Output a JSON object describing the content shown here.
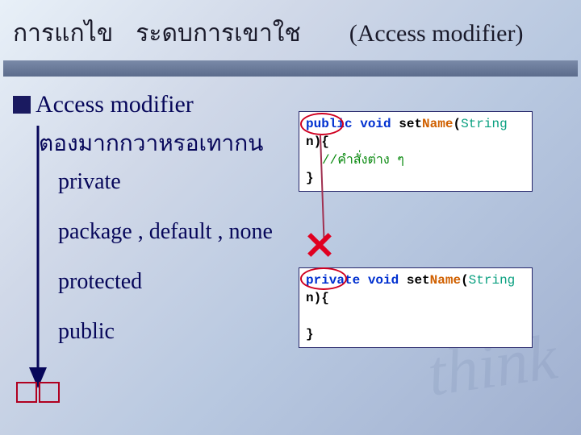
{
  "title": {
    "left_a": "การแกไข",
    "left_b": "ระดบการเขาใช",
    "right": "(Access modifier)"
  },
  "heading": "Access modifier",
  "subline": "ตองมากกวาหรอเทากน",
  "modifiers": {
    "m0": "private",
    "m1": "package , default , none",
    "m2": "protected",
    "m3": "public"
  },
  "code1": {
    "kw_access": "public",
    "kw_ret": "void",
    "name_set": "set",
    "name_rest": "Name",
    "param_type": "String",
    "param_name": "n",
    "open": "){",
    "comment": "//คำสั่งต่าง ๆ",
    "brace_close": "}"
  },
  "code2": {
    "kw_access": "private",
    "kw_ret": "void",
    "name_set": "set",
    "name_rest": "Name",
    "param_type": "String",
    "param_name": "n",
    "open": "){",
    "brace_close": "}"
  }
}
